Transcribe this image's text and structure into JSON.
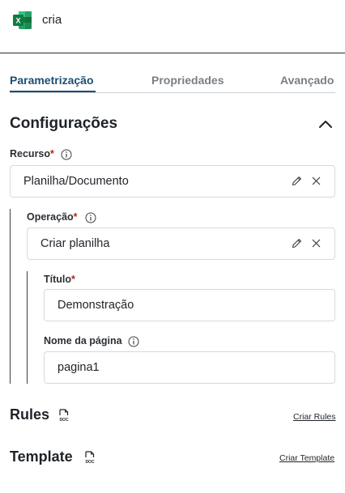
{
  "header": {
    "app_icon": "excel-icon",
    "title": "cria"
  },
  "tabs": [
    {
      "label": "Parametrização",
      "active": true
    },
    {
      "label": "Propriedades",
      "active": false
    },
    {
      "label": "Avançado",
      "active": false
    }
  ],
  "section": {
    "title": "Configurações",
    "collapse_icon": "chevron-up-icon"
  },
  "fields": {
    "recurso": {
      "label": "Recurso",
      "required_mark": "*",
      "value": "Planilha/Documento"
    },
    "operacao": {
      "label": "Operação",
      "required_mark": "*",
      "value": "Criar planilha"
    },
    "titulo": {
      "label": "Título",
      "required_mark": "*",
      "value": "Demonstração"
    },
    "nome_pagina": {
      "label": "Nome da página",
      "value": "pagina1"
    }
  },
  "rules": {
    "title": "Rules",
    "link": "Criar Rules",
    "icon": "doc-icon"
  },
  "template": {
    "title": "Template",
    "link": "Criar Template",
    "icon": "doc-icon"
  },
  "colors": {
    "accent": "#1d4e72",
    "required": "#b3261e",
    "excel_green": "#107c41"
  }
}
